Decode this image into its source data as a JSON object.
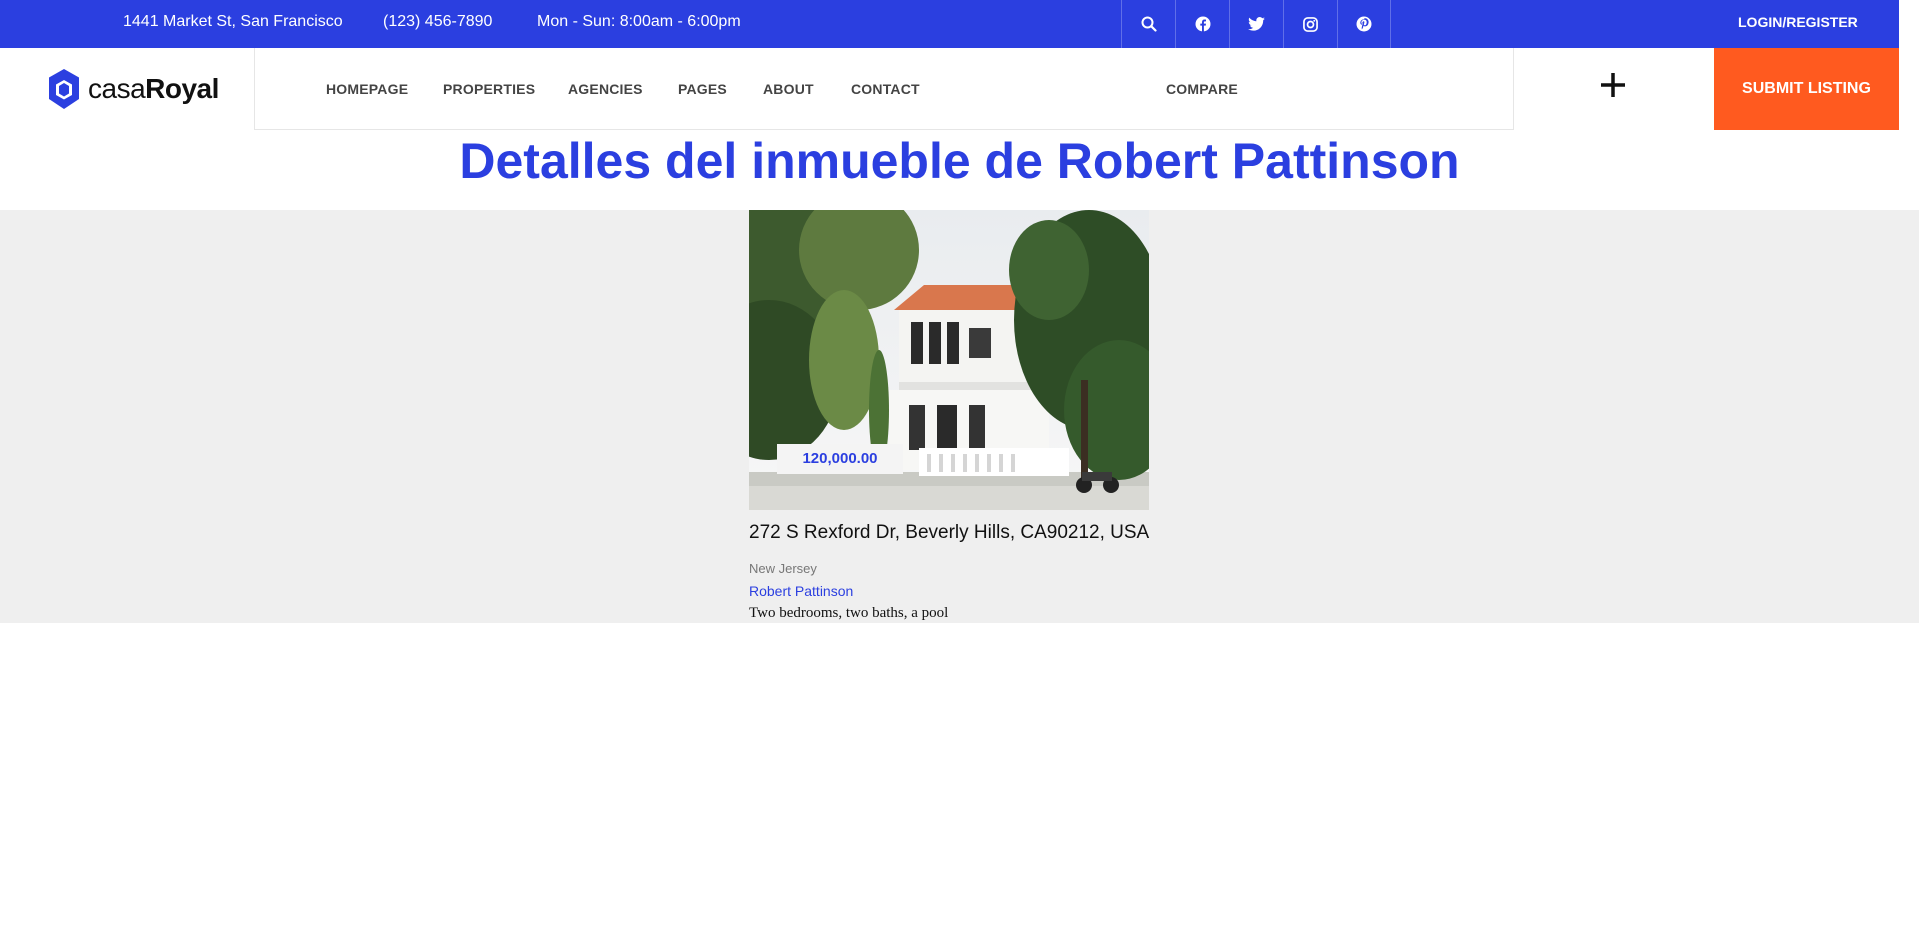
{
  "topbar": {
    "address": "1441 Market St, San Francisco",
    "phone": "(123) 456-7890",
    "hours": "Mon - Sun: 8:00am - 6:00pm",
    "icons": [
      "search-icon",
      "facebook-icon",
      "twitter-icon",
      "instagram-icon",
      "pinterest-icon"
    ],
    "login_label": "LOGIN/REGISTER",
    "bg_color": "#2b3fe0"
  },
  "header": {
    "logo_light": "casa",
    "logo_bold": "Royal",
    "nav": [
      "HOMEPAGE",
      "PROPERTIES",
      "AGENCIES",
      "PAGES",
      "ABOUT",
      "CONTACT"
    ],
    "compare_label": "COMPARE",
    "submit_label": "SUBMIT LISTING",
    "submit_color": "#ff5a1f"
  },
  "page": {
    "title": "Detalles del inmueble de Robert Pattinson"
  },
  "property": {
    "price": "120,000.00",
    "address": "272 S Rexford Dr, Beverly Hills, CA90212, USA",
    "state": "New Jersey",
    "owner": "Robert Pattinson",
    "description": "Two bedrooms, two baths, a pool"
  }
}
